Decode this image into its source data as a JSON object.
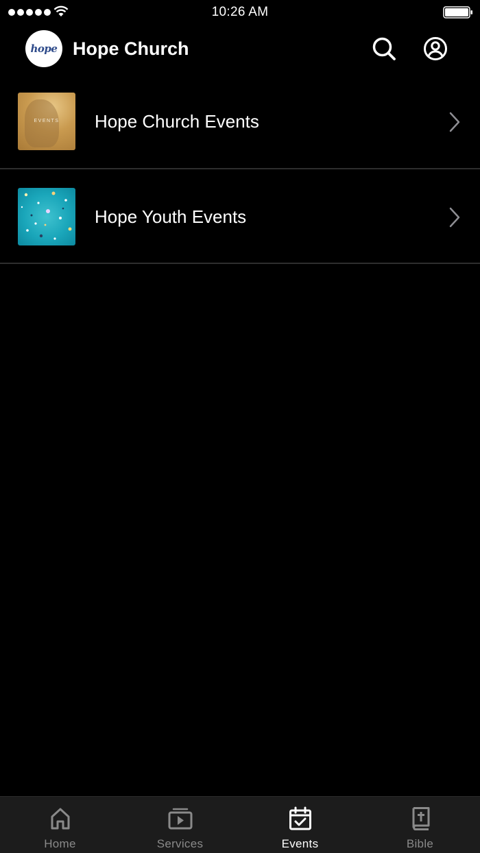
{
  "status_bar": {
    "time": "10:26 AM",
    "signal_icon": "cellular-signal-icon",
    "wifi_icon": "wifi-icon",
    "battery_icon": "battery-icon"
  },
  "header": {
    "logo_text": "hope",
    "title": "Hope Church",
    "search_icon": "search-icon",
    "account_icon": "account-icon"
  },
  "events": {
    "items": [
      {
        "label": "Hope Church Events",
        "thumbnail_text": "EVENTS"
      },
      {
        "label": "Hope Youth Events"
      }
    ]
  },
  "tab_bar": {
    "tabs": [
      {
        "label": "Home",
        "icon": "home-icon",
        "active": false
      },
      {
        "label": "Services",
        "icon": "play-video-icon",
        "active": false
      },
      {
        "label": "Events",
        "icon": "calendar-check-icon",
        "active": true
      },
      {
        "label": "Bible",
        "icon": "bible-icon",
        "active": false
      }
    ]
  },
  "colors": {
    "background": "#000000",
    "tab_bar_bg": "#1c1c1c",
    "tab_inactive": "#8a8a8a",
    "tab_active": "#ffffff",
    "divider": "#2e2e2e",
    "chevron": "#8e8e93"
  }
}
